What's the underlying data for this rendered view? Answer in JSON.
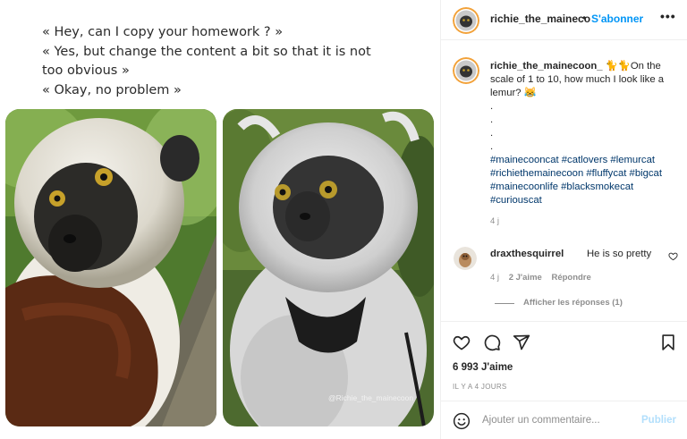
{
  "post_media": {
    "quote_lines": [
      "« Hey, can I copy your homework ? »",
      "« Yes, but change the content a bit so that it is not",
      "too obvious  »",
      "« Okay, no problem »"
    ],
    "watermark": "@Richie_the_mainecoon"
  },
  "header": {
    "username": "richie_the_maineco",
    "separator": "•",
    "follow_label": "S'abonner",
    "more_icon": "more-horizontal-icon"
  },
  "caption": {
    "username": "richie_the_mainecoon_",
    "emoji": "🐈🐈",
    "text": "On the scale of 1 to 10, how much I look like a lemur? 😹",
    "dots": [
      ".",
      ".",
      ".",
      "."
    ],
    "hashtags": [
      "#mainecooncat",
      "#catlovers",
      "#lemurcat",
      "#richiethemainecoon",
      "#fluffycat",
      "#bigcat",
      "#mainecoonlife",
      "#blacksmokecat",
      "#curiouscat"
    ],
    "time": "4 j"
  },
  "comment": {
    "username": "draxthesquirrel",
    "text": "He is so pretty",
    "time": "4 j",
    "likes": "2 J'aime",
    "reply_label": "Répondre",
    "view_replies": "Afficher les réponses (1)"
  },
  "actions": {
    "icons": [
      "heart-icon",
      "comment-icon",
      "share-icon",
      "bookmark-icon"
    ],
    "likes": "6 993 J'aime",
    "ago": "IL Y A 4 JOURS"
  },
  "comment_bar": {
    "placeholder": "Ajouter un commentaire...",
    "publish_label": "Publier",
    "emoji_icon": "smiley-icon"
  },
  "colors": {
    "accent": "#0095f6",
    "hashtag": "#00376b",
    "muted": "#8e8e8e",
    "publish_disabled": "#b2dffc"
  }
}
